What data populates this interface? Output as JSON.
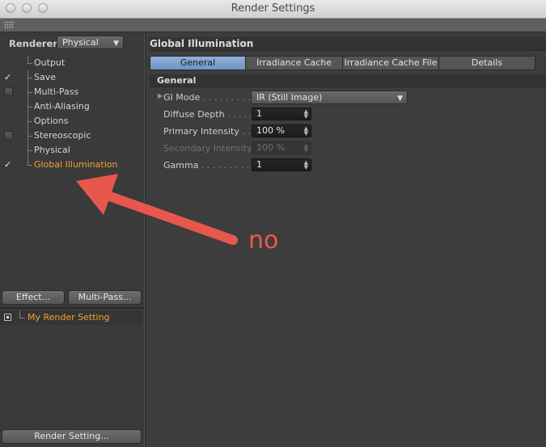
{
  "window": {
    "title": "Render Settings"
  },
  "sidebar": {
    "renderer_label": "Renderer",
    "renderer_value": "Physical",
    "items": [
      {
        "label": "Output",
        "check": "none"
      },
      {
        "label": "Save",
        "check": "checked"
      },
      {
        "label": "Multi-Pass",
        "check": "empty"
      },
      {
        "label": "Anti-Aliasing",
        "check": "none"
      },
      {
        "label": "Options",
        "check": "none"
      },
      {
        "label": "Stereoscopic",
        "check": "empty"
      },
      {
        "label": "Physical",
        "check": "none"
      },
      {
        "label": "Global Illumination",
        "check": "checked",
        "selected": true
      }
    ],
    "checkmark_glyph": "✓",
    "effect_button": "Effect...",
    "multipass_button": "Multi-Pass...",
    "render_setting_item": "My Render Setting",
    "render_setting_button": "Render Setting..."
  },
  "panel": {
    "title": "Global Illumination",
    "tabs": [
      {
        "label": "General",
        "active": true
      },
      {
        "label": "Irradiance Cache",
        "active": false
      },
      {
        "label": "Irradiance Cache File",
        "active": false
      },
      {
        "label": "Details",
        "active": false
      }
    ],
    "section_title": "General",
    "properties": {
      "gi_mode": {
        "label": "GI Mode",
        "value": "IR (Still Image)"
      },
      "diffuse_depth": {
        "label": "Diffuse Depth",
        "value": "1"
      },
      "primary_intensity": {
        "label": "Primary Intensity",
        "value": "100 %"
      },
      "secondary_intensity": {
        "label": "Secondary Intensity",
        "value": "100 %",
        "disabled": true
      },
      "gamma": {
        "label": "Gamma",
        "value": "1"
      }
    }
  },
  "annotation": {
    "text": "no",
    "color": "#e8574c"
  },
  "colors": {
    "accent_orange": "#f0a22e",
    "tab_active": "#7ea1cf"
  }
}
